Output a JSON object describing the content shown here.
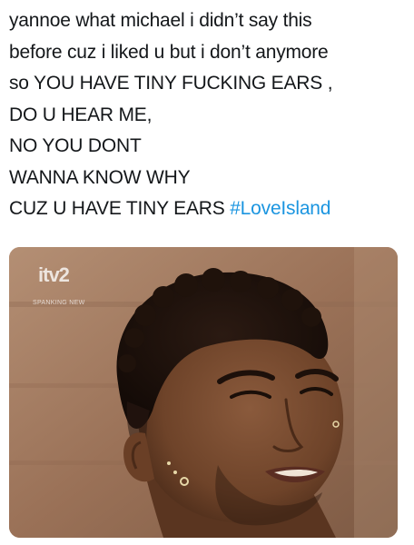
{
  "tweet": {
    "lines": [
      "yannoe what michael i didn’t say this",
      "before cuz i liked u but i don’t anymore",
      "so YOU HAVE TINY FUCKING EARS ,",
      "DO U HEAR ME,",
      "NO YOU DONT",
      "WANNA KNOW WHY"
    ],
    "last_line": "CUZ U HAVE TINY EARS",
    "hashtag": "#LoveIsland"
  },
  "media": {
    "broadcaster_logo": "itv2",
    "broadcaster_tagline": "SPANKING NEW",
    "image_subject": "close-up of a man with short curly hair squinting"
  },
  "colors": {
    "text": "#14171a",
    "hashtag": "#1b95e0",
    "background": "#ffffff"
  }
}
